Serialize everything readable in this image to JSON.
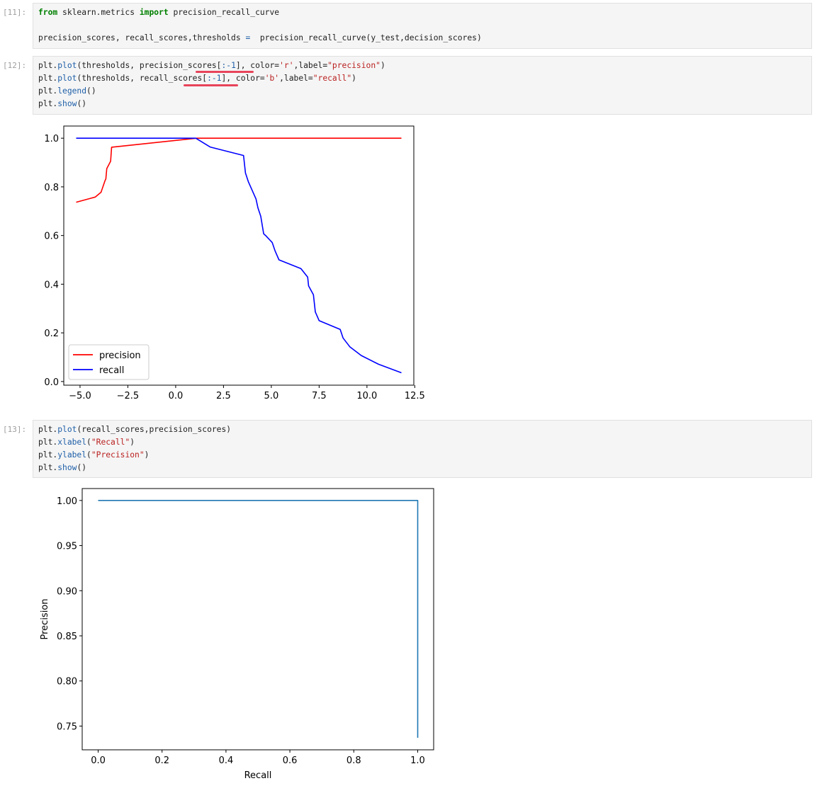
{
  "cells": [
    {
      "prompt": "[11]:",
      "lines": [
        [
          {
            "t": "kw",
            "v": "from"
          },
          {
            "t": "",
            "v": " sklearn.metrics "
          },
          {
            "t": "kw",
            "v": "import"
          },
          {
            "t": "",
            "v": " precision_recall_curve"
          }
        ],
        [],
        [
          {
            "t": "",
            "v": "precision_scores, recall_scores,thresholds "
          },
          {
            "t": "attr",
            "v": "="
          },
          {
            "t": "",
            "v": "  precision_recall_curve(y_test,decision_scores)"
          }
        ]
      ]
    },
    {
      "prompt": "[12]:",
      "lines": [
        [
          {
            "t": "",
            "v": "plt."
          },
          {
            "t": "attr",
            "v": "plot"
          },
          {
            "t": "",
            "v": "(thresholds, precision_scores["
          },
          {
            "t": "attr",
            "v": ":-1"
          },
          {
            "t": "",
            "v": "], color="
          },
          {
            "t": "str",
            "v": "'r'"
          },
          {
            "t": "",
            "v": ",label="
          },
          {
            "t": "str",
            "v": "\"precision\""
          },
          {
            "t": "",
            "v": ")"
          }
        ],
        [
          {
            "t": "",
            "v": "plt."
          },
          {
            "t": "attr",
            "v": "plot"
          },
          {
            "t": "",
            "v": "(thresholds, recall_scores["
          },
          {
            "t": "attr",
            "v": ":-1"
          },
          {
            "t": "",
            "v": "], color="
          },
          {
            "t": "str",
            "v": "'b'"
          },
          {
            "t": "",
            "v": ",label="
          },
          {
            "t": "str",
            "v": "\"recall\""
          },
          {
            "t": "",
            "v": ")"
          }
        ],
        [
          {
            "t": "",
            "v": "plt."
          },
          {
            "t": "attr",
            "v": "legend"
          },
          {
            "t": "",
            "v": "()"
          }
        ],
        [
          {
            "t": "",
            "v": "plt."
          },
          {
            "t": "attr",
            "v": "show"
          },
          {
            "t": "",
            "v": "()"
          }
        ]
      ]
    },
    {
      "prompt": "[13]:",
      "lines": [
        [
          {
            "t": "",
            "v": "plt."
          },
          {
            "t": "attr",
            "v": "plot"
          },
          {
            "t": "",
            "v": "(recall_scores,precision_scores)"
          }
        ],
        [
          {
            "t": "",
            "v": "plt."
          },
          {
            "t": "attr",
            "v": "xlabel"
          },
          {
            "t": "",
            "v": "("
          },
          {
            "t": "str",
            "v": "\"Recall\""
          },
          {
            "t": "",
            "v": ")"
          }
        ],
        [
          {
            "t": "",
            "v": "plt."
          },
          {
            "t": "attr",
            "v": "ylabel"
          },
          {
            "t": "",
            "v": "("
          },
          {
            "t": "str",
            "v": "\"Precision\""
          },
          {
            "t": "",
            "v": ")"
          }
        ],
        [
          {
            "t": "",
            "v": "plt."
          },
          {
            "t": "attr",
            "v": "show"
          },
          {
            "t": "",
            "v": "()"
          }
        ]
      ]
    }
  ],
  "colors": {
    "precision": "#ff0000",
    "recall": "#0000ff",
    "pr_curve": "#1f77b4",
    "annotation": "#e8445a"
  },
  "chart_data": [
    {
      "type": "line",
      "title": "",
      "xlabel": "",
      "ylabel": "",
      "xlim": [
        -5.85,
        12.45
      ],
      "ylim": [
        -0.015,
        1.05
      ],
      "xticks": [
        -5.0,
        -2.5,
        0.0,
        2.5,
        5.0,
        7.5,
        10.0,
        12.5
      ],
      "xtick_labels": [
        "−5.0",
        "−2.5",
        "0.0",
        "2.5",
        "5.0",
        "7.5",
        "10.0",
        "12.5"
      ],
      "yticks": [
        0.0,
        0.2,
        0.4,
        0.6,
        0.8,
        1.0
      ],
      "ytick_labels": [
        "0.0",
        "0.2",
        "0.4",
        "0.6",
        "0.8",
        "1.0"
      ],
      "legend_position": "lower-left",
      "series": [
        {
          "name": "precision",
          "color": "#ff0000",
          "x": [
            -5.2,
            -4.2,
            -3.9,
            -3.7,
            -3.65,
            -3.6,
            -3.4,
            -3.35,
            1.1,
            11.8
          ],
          "y": [
            0.737,
            0.758,
            0.778,
            0.824,
            0.833,
            0.875,
            0.905,
            0.963,
            1.0,
            1.0
          ]
        },
        {
          "name": "recall",
          "color": "#0000ff",
          "x": [
            -5.2,
            1.05,
            1.8,
            3.55,
            3.65,
            3.8,
            4.2,
            4.3,
            4.45,
            4.6,
            4.7,
            5.05,
            5.2,
            5.4,
            6.55,
            6.9,
            6.95,
            7.2,
            7.3,
            7.5,
            8.6,
            8.75,
            9.1,
            9.7,
            10.6,
            11.8
          ],
          "y": [
            1.0,
            1.0,
            0.964,
            0.929,
            0.857,
            0.821,
            0.75,
            0.714,
            0.679,
            0.607,
            0.6,
            0.571,
            0.536,
            0.5,
            0.464,
            0.429,
            0.393,
            0.357,
            0.286,
            0.25,
            0.214,
            0.179,
            0.143,
            0.107,
            0.071,
            0.036
          ]
        }
      ]
    },
    {
      "type": "line",
      "title": "",
      "xlabel": "Recall",
      "ylabel": "Precision",
      "xlim": [
        -0.05,
        1.05
      ],
      "ylim": [
        0.7237,
        1.0132
      ],
      "xticks": [
        0.0,
        0.2,
        0.4,
        0.6,
        0.8,
        1.0
      ],
      "xtick_labels": [
        "0.0",
        "0.2",
        "0.4",
        "0.6",
        "0.8",
        "1.0"
      ],
      "yticks": [
        0.75,
        0.8,
        0.85,
        0.9,
        0.95,
        1.0
      ],
      "ytick_labels": [
        "0.75",
        "0.80",
        "0.85",
        "0.90",
        "0.95",
        "1.00"
      ],
      "series": [
        {
          "color": "#1f77b4",
          "x": [
            0.0,
            1.0,
            1.0
          ],
          "y": [
            1.0,
            1.0,
            0.737
          ]
        }
      ]
    }
  ]
}
